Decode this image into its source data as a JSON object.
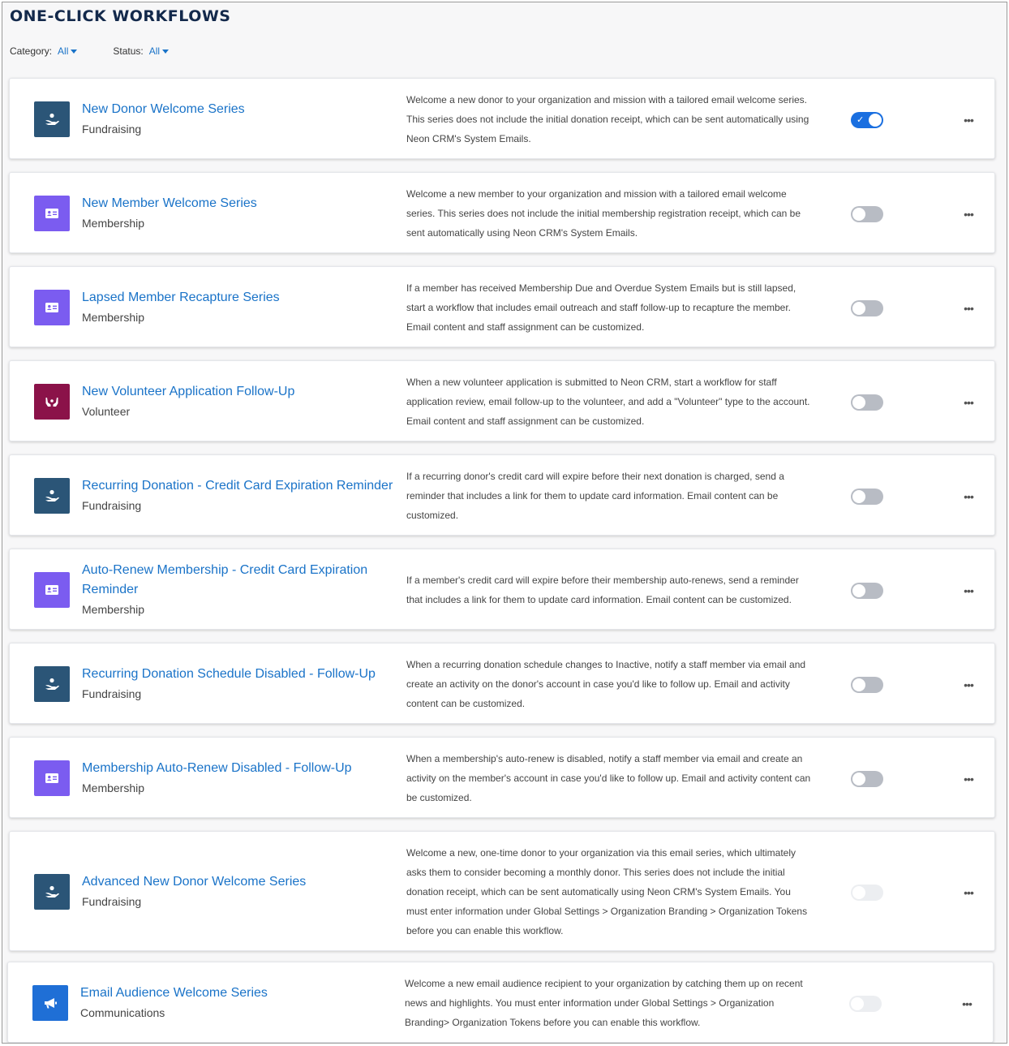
{
  "page": {
    "title": "ONE-CLICK WORKFLOWS"
  },
  "filters": {
    "category": {
      "label": "Category:",
      "value": "All"
    },
    "status": {
      "label": "Status:",
      "value": "All"
    }
  },
  "colors": {
    "fundraising": "#2b5577",
    "membership": "#7b5cf0",
    "volunteer": "#8b1249",
    "communications": "#1f6fd6",
    "link": "#1a73c8",
    "toggle_on": "#1a6fe0"
  },
  "workflows": [
    {
      "title": "New Donor Welcome Series",
      "category": "Fundraising",
      "icon": "donation-hand-icon",
      "status": "on",
      "description": "Welcome a new donor to your organization and mission with a tailored email welcome series. This series does not include the initial donation receipt, which can be sent automatically using Neon CRM's System Emails."
    },
    {
      "title": "New Member Welcome Series",
      "category": "Membership",
      "icon": "membership-card-icon",
      "status": "off",
      "description": "Welcome a new member to your organization and mission with a tailored email welcome series. This series does not include the initial membership registration receipt, which can be sent automatically using Neon CRM's System Emails."
    },
    {
      "title": "Lapsed Member Recapture Series",
      "category": "Membership",
      "icon": "membership-card-icon",
      "status": "off",
      "description": "If a member has received Membership Due and Overdue System Emails but is still lapsed, start a workflow that includes email outreach and staff follow-up to recapture the member. Email content and staff assignment can be customized."
    },
    {
      "title": "New Volunteer Application Follow-Up",
      "category": "Volunteer",
      "icon": "volunteer-hands-icon",
      "status": "off",
      "description": "When a new volunteer application is submitted to Neon CRM, start a workflow for staff application review, email follow-up to the volunteer, and add a \"Volunteer\" type to the account. Email content and staff assignment can be customized."
    },
    {
      "title": "Recurring Donation - Credit Card Expiration Reminder",
      "category": "Fundraising",
      "icon": "donation-hand-icon",
      "status": "off",
      "description": "If a recurring donor's credit card will expire before their next donation is charged, send a reminder that includes a link for them to update card information. Email content can be customized."
    },
    {
      "title": "Auto-Renew Membership - Credit Card Expiration Reminder",
      "category": "Membership",
      "icon": "membership-card-icon",
      "status": "off",
      "description": "If a member's credit card will expire before their membership auto-renews, send a reminder that includes a link for them to update card information. Email content can be customized."
    },
    {
      "title": "Recurring Donation Schedule Disabled - Follow-Up",
      "category": "Fundraising",
      "icon": "donation-hand-icon",
      "status": "off",
      "description": "When a recurring donation schedule changes to Inactive, notify a staff member via email and create an activity on the donor's account in case you'd like to follow up. Email and activity content can be customized."
    },
    {
      "title": "Membership Auto-Renew Disabled - Follow-Up",
      "category": "Membership",
      "icon": "membership-card-icon",
      "status": "off",
      "description": "When a membership's auto-renew is disabled, notify a staff member via email and create an activity on the member's account in case you'd like to follow up. Email and activity content can be customized."
    },
    {
      "title": "Advanced New Donor Welcome Series",
      "category": "Fundraising",
      "icon": "donation-hand-icon",
      "status": "disabled",
      "description": "Welcome a new, one-time donor to your organization via this email series, which ultimately asks them to consider becoming a monthly donor. This series does not include the initial donation receipt, which can be sent automatically using Neon CRM's System Emails. You must enter information under Global Settings > Organization Branding > Organization Tokens before you can enable this workflow."
    },
    {
      "title": "Email Audience Welcome Series",
      "category": "Communications",
      "icon": "megaphone-icon",
      "status": "disabled",
      "description": "Welcome a new email audience recipient to your organization by catching them up on recent news and highlights. You must enter information under Global Settings > Organization Branding> Organization Tokens before you can enable this workflow."
    }
  ],
  "more_label": "•••",
  "toggle_check": "✓"
}
